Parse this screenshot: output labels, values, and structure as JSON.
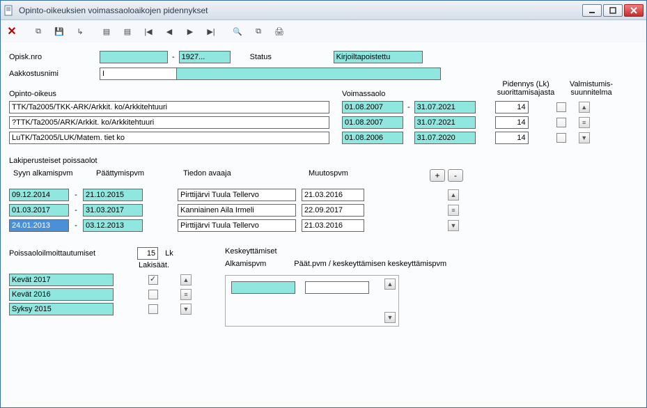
{
  "window": {
    "title": "Opinto-oikeuksien voimassaoloaikojen pidennykset"
  },
  "student": {
    "opisk_label": "Opisk.nro",
    "opisk_left": "",
    "opisk_right": "1927...",
    "status_label": "Status",
    "status_value": "Kirjoiltapoistettu",
    "aakkostus_label": "Aakkostusnimi",
    "aakkostus_value_left": "I",
    "aakkostus_value_right": ""
  },
  "rights": {
    "header_opinto": "Opinto-oikeus",
    "header_voimassa": "Voimassaolo",
    "header_pidennys1": "Pidennys (Lk)",
    "header_pidennys2": "suorittamisajasta",
    "header_valm1": "Valmistumis-",
    "header_valm2": "suunnitelma",
    "rows": [
      {
        "name": "TTK/Ta2005/TKK-ARK/Arkkit. ko/Arkkitehtuuri",
        "start": "01.08.2007",
        "end": "31.07.2021",
        "ext": "14"
      },
      {
        "name": "?TTK/Ta2005/ARK/Arkkit. ko/Arkkitehtuuri",
        "start": "01.08.2007",
        "end": "31.07.2021",
        "ext": "14"
      },
      {
        "name": "LuTK/Ta2005/LUK/Matem. tiet ko",
        "start": "01.08.2006",
        "end": "31.07.2020",
        "ext": "14"
      }
    ]
  },
  "absences": {
    "title": "Lakiperusteiset poissaolot",
    "col_start": "Syyn alkamispvm",
    "col_end": "Päättymispvm",
    "col_opener": "Tiedon avaaja",
    "col_changed": "Muutospvm",
    "rows": [
      {
        "start": "09.12.2014",
        "end": "21.10.2015",
        "opener": "Pirttijärvi Tuula Tellervo",
        "changed": "21.03.2016"
      },
      {
        "start": "01.03.2017",
        "end": "31.03.2017",
        "opener": "Kanniainen Aila Irmeli",
        "changed": "22.09.2017"
      },
      {
        "start": "24.01.2013",
        "end": "03.12.2013",
        "opener": "Pirttijärvi Tuula Tellervo",
        "changed": "21.03.2016"
      }
    ]
  },
  "terms": {
    "title": "Poissaoloilmoittautumiset",
    "count": "15",
    "lk": "Lk",
    "lakisaat": "Lakisäät.",
    "rows": [
      {
        "name": "Kevät 2017",
        "checked": true
      },
      {
        "name": "Kevät 2016",
        "checked": false
      },
      {
        "name": "Syksy 2015",
        "checked": false
      }
    ]
  },
  "kesk": {
    "title": "Keskeyttämiset",
    "col1": "Alkamispvm",
    "col2": "Päät.pvm / keskeyttämisen keskeyttämispvm",
    "val1": "",
    "val2": ""
  }
}
